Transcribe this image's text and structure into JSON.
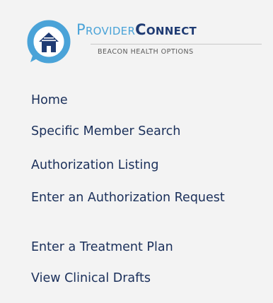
{
  "logo": {
    "brand_part1": "Provider",
    "brand_part2": "Connect",
    "tagline": "BEACON HEALTH OPTIONS",
    "icon": "house-chat-bubble-icon",
    "colors": {
      "light_blue": "#4aa3d8",
      "navy": "#1f3b73"
    }
  },
  "nav": {
    "items": [
      {
        "label": "Home"
      },
      {
        "label": "Specific Member Search"
      },
      {
        "label": "Authorization Listing"
      },
      {
        "label": "Enter an Authorization Request"
      },
      {
        "label": "Enter a Treatment Plan"
      },
      {
        "label": "View Clinical Drafts"
      }
    ],
    "link_color": "#1a2f5a",
    "background": "#f3f3f3"
  }
}
